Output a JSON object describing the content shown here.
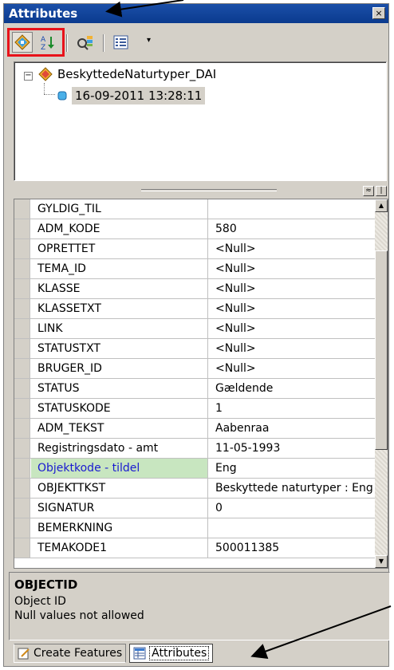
{
  "window": {
    "title": "Attributes",
    "close_glyph": "×"
  },
  "toolbar": {
    "buttons": [
      {
        "name": "list-by-layer-icon",
        "pressed": true
      },
      {
        "name": "sort-az-icon",
        "pressed": false
      },
      {
        "name": "identify-icon",
        "pressed": false
      },
      {
        "name": "options-list-icon",
        "pressed": false
      }
    ],
    "dropdown_glyph": "▾"
  },
  "tree": {
    "expander": "⊟",
    "layer": "BeskyttedeNaturtyper_DAI",
    "feature": "16-09-2011 13:28:11"
  },
  "attributes": [
    {
      "field": "GYLDIG_TIL",
      "value": ""
    },
    {
      "field": "ADM_KODE",
      "value": "580"
    },
    {
      "field": "OPRETTET",
      "value": "<Null>"
    },
    {
      "field": "TEMA_ID",
      "value": "<Null>"
    },
    {
      "field": "KLASSE",
      "value": "<Null>"
    },
    {
      "field": "KLASSETXT",
      "value": "<Null>"
    },
    {
      "field": "LINK",
      "value": "<Null>"
    },
    {
      "field": "STATUSTXT",
      "value": "<Null>"
    },
    {
      "field": "BRUGER_ID",
      "value": "<Null>"
    },
    {
      "field": "STATUS",
      "value": "Gældende"
    },
    {
      "field": "STATUSKODE",
      "value": "1"
    },
    {
      "field": "ADM_TEKST",
      "value": "Aabenraa"
    },
    {
      "field": "Registringsdato - amt",
      "value": "11-05-1993"
    },
    {
      "field": "Objektkode - tildel",
      "value": "Eng",
      "selected": true
    },
    {
      "field": "OBJEKTTKST",
      "value": "Beskyttede naturtyper : Eng"
    },
    {
      "field": "SIGNATUR",
      "value": "0"
    },
    {
      "field": "BEMERKNING",
      "value": ""
    },
    {
      "field": "TEMAKODE1",
      "value": "500011385"
    }
  ],
  "description": {
    "title": "OBJECTID",
    "line1": "Object ID",
    "line2": "Null values not allowed"
  },
  "tabs": [
    {
      "label": "Create Features",
      "active": false
    },
    {
      "label": "Attributes",
      "active": true
    }
  ],
  "colors": {
    "title_bar": "#0a3a8e",
    "highlight_box": "#e8121a",
    "selected_field_bg": "#c8e6c0",
    "selected_field_text": "#1a1ad0"
  }
}
